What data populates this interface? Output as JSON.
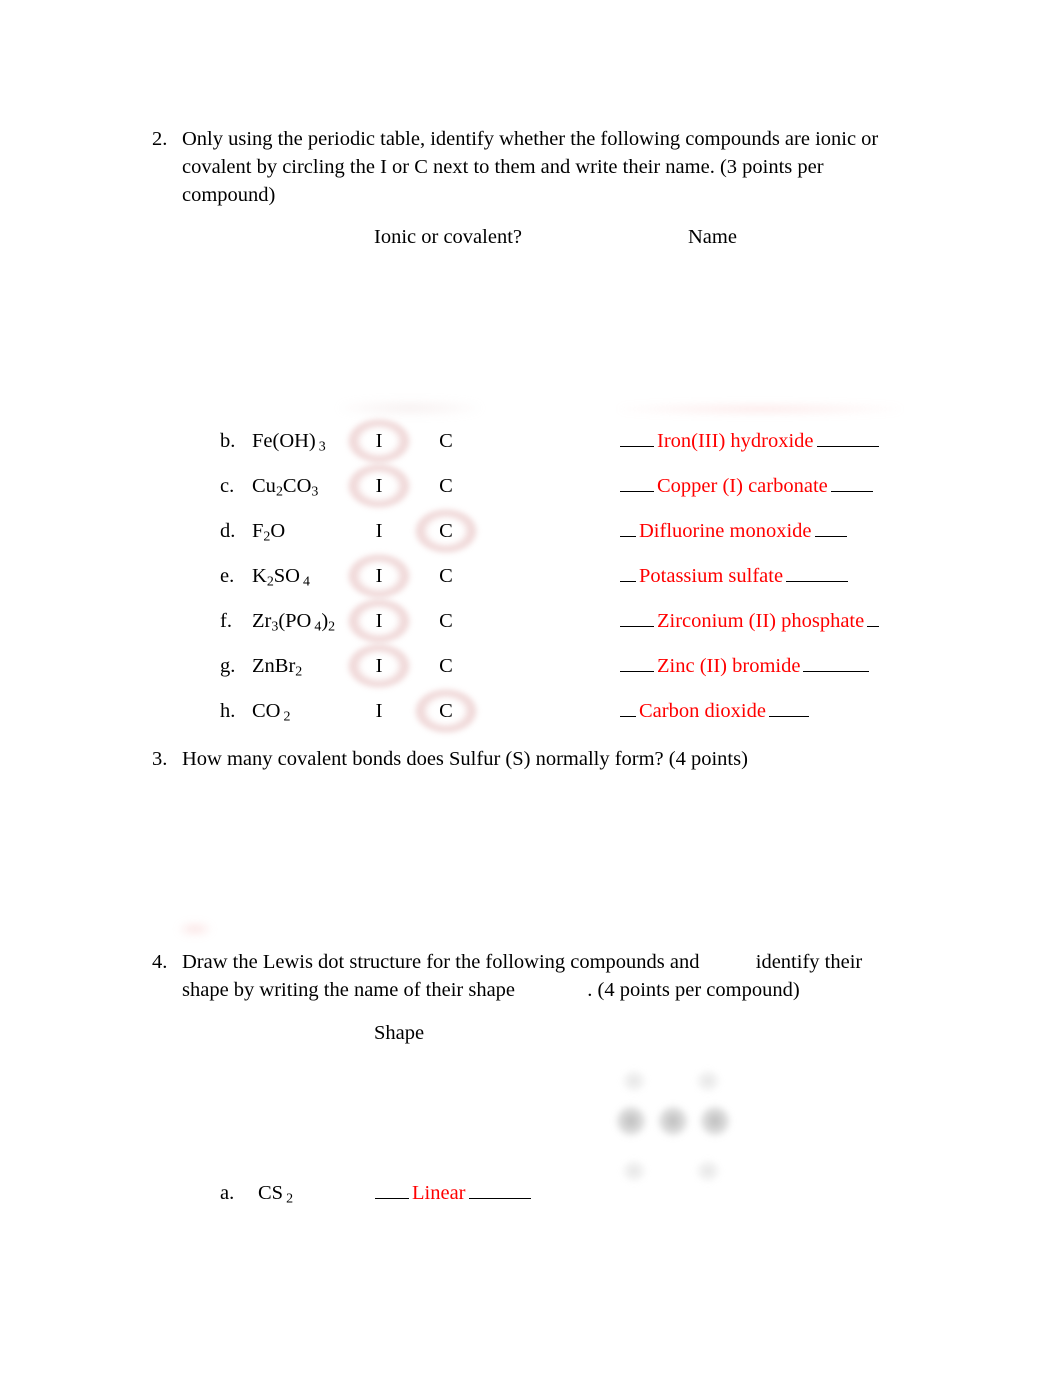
{
  "document": {
    "questions": [
      {
        "number": "2.",
        "text": "Only using the periodic table, identify whether the following compounds are ionic or covalent by circling the I or C next to them and write their name. (3 points per compound)"
      },
      {
        "number": "3.",
        "text": "How many covalent bonds does Sulfur (S) normally form? (4 points)"
      },
      {
        "number": "4.",
        "text_part1": "Draw the Lewis dot structure for the following compounds and",
        "text_part2": "identify their shape by writing the name of their shape",
        "text_part3": ". (4 points per compound)"
      }
    ],
    "headers": {
      "ionic_or_covalent": "Ionic or covalent?",
      "name": "Name",
      "shape": "Shape"
    },
    "answer_color": "#ff0000",
    "compounds": [
      {
        "letter": "b.",
        "formula_html": "Fe(OH)<span class=\"sp\"></span><sub>3</sub>",
        "formula_text": "Fe(OH)3",
        "choice_i": "I",
        "choice_c": "C",
        "circled": "I",
        "answer": "Iron(III) hydroxide",
        "blank_before_width": 34,
        "blank_after_width": 62
      },
      {
        "letter": "c.",
        "formula_html": "Cu<sub>2</sub>CO<sub>3</sub>",
        "formula_text": "Cu2CO3",
        "choice_i": "I",
        "choice_c": "C",
        "circled": "I",
        "answer": "Copper (I) carbonate",
        "blank_before_width": 34,
        "blank_after_width": 42
      },
      {
        "letter": "d.",
        "formula_html": "F<sub>2</sub>O",
        "formula_text": "F2O",
        "choice_i": "I",
        "choice_c": "C",
        "circled": "C",
        "answer": "Difluorine monoxide",
        "blank_before_width": 16,
        "blank_after_width": 32
      },
      {
        "letter": "e.",
        "formula_html": "K<sub>2</sub>SO<span class=\"sp\"></span><sub>4</sub>",
        "formula_text": "K2SO4",
        "choice_i": "I",
        "choice_c": "C",
        "circled": "I",
        "answer": "Potassium sulfate",
        "blank_before_width": 16,
        "blank_after_width": 62
      },
      {
        "letter": "f.",
        "formula_html": "Zr<sub>3</sub>(PO<span class=\"sp\"></span><sub>4</sub>)<sub>2</sub>",
        "formula_text": "Zr3(PO4)2",
        "choice_i": "I",
        "choice_c": "C",
        "circled": "I",
        "answer": "Zirconium (II) phosphate",
        "blank_before_width": 34,
        "blank_after_width": 12
      },
      {
        "letter": "g.",
        "formula_html": "ZnBr<sub>2</sub>",
        "formula_text": "ZnBr2",
        "choice_i": "I",
        "choice_c": "C",
        "circled": "I",
        "answer": "Zinc (II) bromide",
        "blank_before_width": 34,
        "blank_after_width": 66
      },
      {
        "letter": "h.",
        "formula_html": "CO<span class=\"sp\"></span><sub>2</sub>",
        "formula_text": "CO2",
        "choice_i": "I",
        "choice_c": "C",
        "circled": "C",
        "answer": "Carbon dioxide",
        "blank_before_width": 16,
        "blank_after_width": 40
      }
    ],
    "shape_items": [
      {
        "letter": "a.",
        "formula_html": "CS<span class=\"sp\"></span><sub>2</sub>",
        "formula_text": "CS2",
        "answer": "Linear",
        "blank_before_width": 34,
        "blank_after_width": 62
      }
    ]
  }
}
